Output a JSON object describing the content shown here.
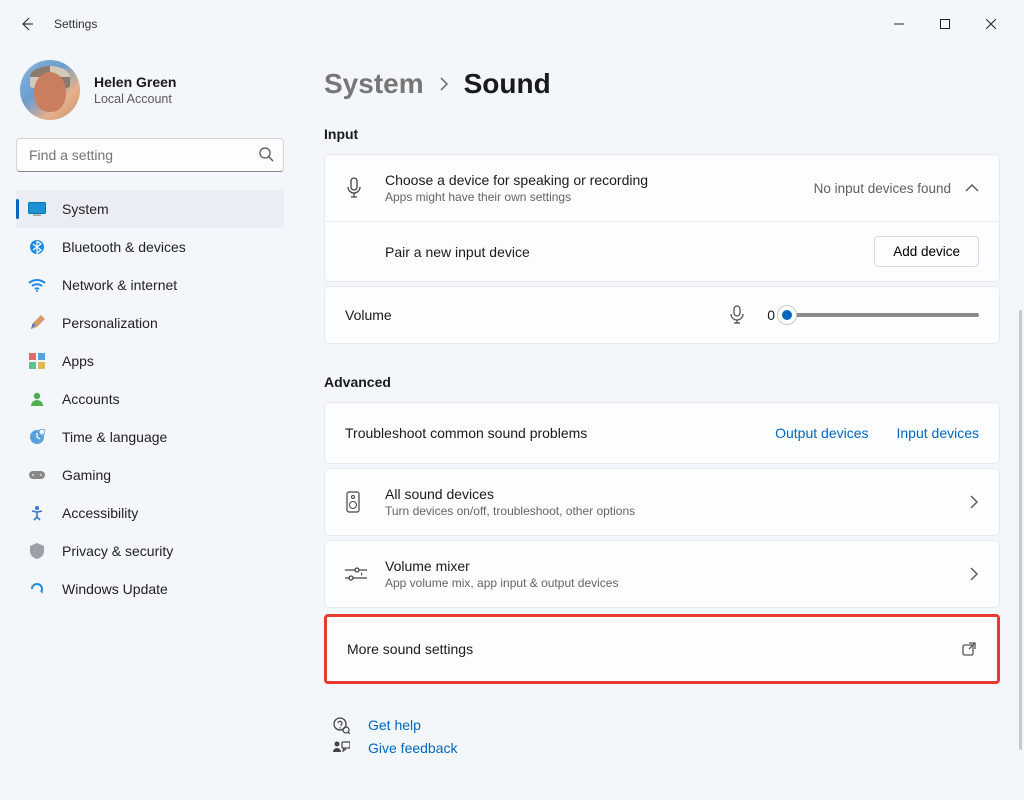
{
  "window": {
    "title": "Settings"
  },
  "profile": {
    "name": "Helen Green",
    "type": "Local Account"
  },
  "search": {
    "placeholder": "Find a setting"
  },
  "nav": {
    "items": [
      {
        "label": "System",
        "icon": "display-icon",
        "selected": true
      },
      {
        "label": "Bluetooth & devices",
        "icon": "bluetooth-icon",
        "selected": false
      },
      {
        "label": "Network & internet",
        "icon": "wifi-icon",
        "selected": false
      },
      {
        "label": "Personalization",
        "icon": "paint-icon",
        "selected": false
      },
      {
        "label": "Apps",
        "icon": "apps-icon",
        "selected": false
      },
      {
        "label": "Accounts",
        "icon": "person-icon",
        "selected": false
      },
      {
        "label": "Time & language",
        "icon": "clock-icon",
        "selected": false
      },
      {
        "label": "Gaming",
        "icon": "gamepad-icon",
        "selected": false
      },
      {
        "label": "Accessibility",
        "icon": "accessibility-icon",
        "selected": false
      },
      {
        "label": "Privacy & security",
        "icon": "shield-icon",
        "selected": false
      },
      {
        "label": "Windows Update",
        "icon": "update-icon",
        "selected": false
      }
    ]
  },
  "breadcrumb": {
    "parent": "System",
    "current": "Sound"
  },
  "sections": {
    "input": {
      "heading": "Input",
      "choose": {
        "title": "Choose a device for speaking or recording",
        "sub": "Apps might have their own settings",
        "status": "No input devices found"
      },
      "pair": {
        "title": "Pair a new input device",
        "button": "Add device"
      },
      "volume": {
        "label": "Volume",
        "value": "0",
        "percent": 0
      }
    },
    "advanced": {
      "heading": "Advanced",
      "troubleshoot": {
        "title": "Troubleshoot common sound problems",
        "output_link": "Output devices",
        "input_link": "Input devices"
      },
      "all_devices": {
        "title": "All sound devices",
        "sub": "Turn devices on/off, troubleshoot, other options"
      },
      "mixer": {
        "title": "Volume mixer",
        "sub": "App volume mix, app input & output devices"
      },
      "more": {
        "title": "More sound settings"
      }
    }
  },
  "help": {
    "get_help": "Get help",
    "feedback": "Give feedback"
  },
  "colors": {
    "accent": "#0067c0",
    "highlight": "#e83a2e"
  }
}
